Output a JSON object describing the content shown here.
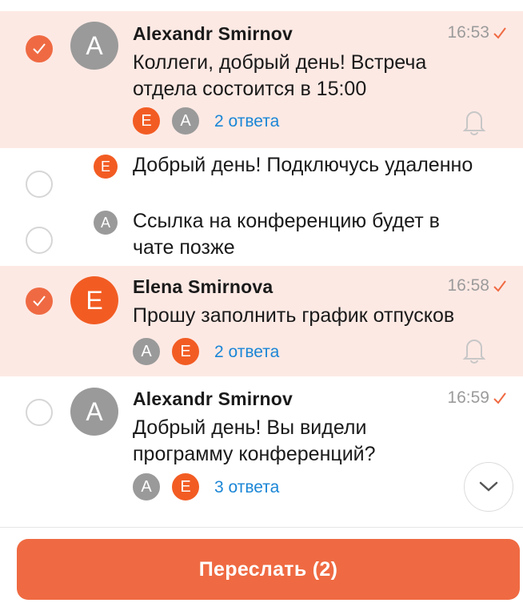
{
  "messages": [
    {
      "author": "Alexandr Smirnov",
      "avatar_letter": "A",
      "time": "16:53",
      "text_lines": [
        "Коллеги, добрый день! Встреча",
        "отдела состоится в 15:00"
      ],
      "reply_avatars": [
        "E",
        "A"
      ],
      "replies_label": "2 ответа",
      "selected": true
    },
    {
      "avatar_letter": "E",
      "text_lines": [
        "Добрый день! Подключусь удаленно"
      ],
      "selected": false
    },
    {
      "avatar_letter": "A",
      "text_lines": [
        "Ссылка на конференцию будет в",
        "чате позже"
      ],
      "selected": false
    },
    {
      "author": "Elena Smirnova",
      "avatar_letter": "E",
      "time": "16:58",
      "text_lines": [
        "Прошу заполнить график отпусков"
      ],
      "reply_avatars": [
        "A",
        "E"
      ],
      "replies_label": "2 ответа",
      "selected": true
    },
    {
      "author": "Alexandr Smirnov",
      "avatar_letter": "A",
      "time": "16:59",
      "text_lines": [
        "Добрый день! Вы видели",
        "программу конференций?"
      ],
      "reply_avatars": [
        "A",
        "E"
      ],
      "replies_label": "3 ответа",
      "selected": false
    }
  ],
  "forward_button": "Переслать (2)",
  "colors": {
    "accent": "#ef6a42",
    "selected_bg": "#fde9e4",
    "link": "#1a86d6",
    "avatar_gray": "#9a9a9a",
    "avatar_orange": "#f25c23"
  },
  "icons": {
    "check": "check-icon",
    "read": "read-check-icon",
    "bell": "bell-icon",
    "scroll": "chevron-down-icon"
  }
}
